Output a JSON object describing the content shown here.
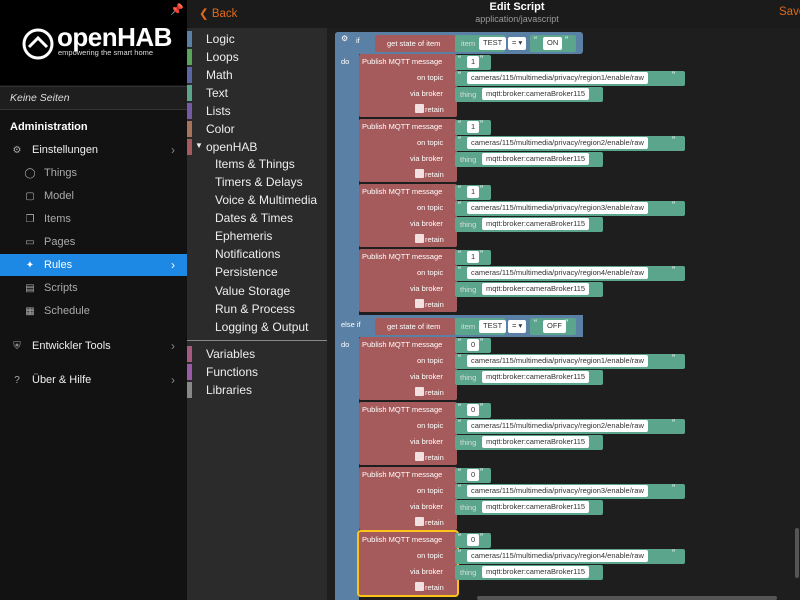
{
  "sidebar": {
    "logo_name": "openHAB",
    "logo_tagline": "empowering the smart home",
    "no_pages": "Keine Seiten",
    "admin_title": "Administration",
    "settings": "Einstellungen",
    "items": [
      {
        "label": "Things",
        "icon": "lightbulb-icon"
      },
      {
        "label": "Model",
        "icon": "cube-icon"
      },
      {
        "label": "Items",
        "icon": "items-icon"
      },
      {
        "label": "Pages",
        "icon": "monitor-icon"
      },
      {
        "label": "Rules",
        "icon": "sparkle-icon",
        "active": true
      },
      {
        "label": "Scripts",
        "icon": "document-icon"
      },
      {
        "label": "Schedule",
        "icon": "calendar-icon"
      }
    ],
    "dev_tools": "Entwickler Tools",
    "help": "Über & Hilfe"
  },
  "header": {
    "back": "Back",
    "title": "Edit Script",
    "subtitle": "application/javascript",
    "save": "Save"
  },
  "toolbox": {
    "categories": [
      {
        "label": "Logic",
        "color": "#5b80a5"
      },
      {
        "label": "Loops",
        "color": "#5ba55b"
      },
      {
        "label": "Math",
        "color": "#5b67a5"
      },
      {
        "label": "Text",
        "color": "#5ba58c"
      },
      {
        "label": "Lists",
        "color": "#745ba5"
      },
      {
        "label": "Color",
        "color": "#a5745b"
      },
      {
        "label": "openHAB",
        "color": "#a55b5b"
      }
    ],
    "openhab_sub": [
      "Items & Things",
      "Timers & Delays",
      "Voice & Multimedia",
      "Dates & Times",
      "Ephemeris",
      "Notifications",
      "Persistence",
      "Value Storage",
      "Run & Process",
      "Logging & Output"
    ],
    "bottom": [
      {
        "label": "Variables",
        "color": "#a55b80"
      },
      {
        "label": "Functions",
        "color": "#995ba5"
      },
      {
        "label": "Libraries",
        "color": "#888888"
      }
    ]
  },
  "blocks": {
    "if_label": "if",
    "elseif_label": "else if",
    "do_label": "do",
    "get_state": "get state of item",
    "item_label": "item",
    "item_name": "TEST",
    "eq": "= ▾",
    "on_value": "ON",
    "off_value": "OFF",
    "publish": "Publish MQTT message",
    "on_topic": "on topic",
    "via_broker": "via broker",
    "thing_label": "thing",
    "broker": "mqtt:broker:cameraBroker115",
    "retain": "retain",
    "group1": [
      {
        "payload": "1",
        "topic": "cameras/115/multimedia/privacy/region1/enable/raw"
      },
      {
        "payload": "1",
        "topic": "cameras/115/multimedia/privacy/region2/enable/raw"
      },
      {
        "payload": "1",
        "topic": "cameras/115/multimedia/privacy/region3/enable/raw"
      },
      {
        "payload": "1",
        "topic": "cameras/115/multimedia/privacy/region4/enable/raw"
      }
    ],
    "group2": [
      {
        "payload": "0",
        "topic": "cameras/115/multimedia/privacy/region1/enable/raw"
      },
      {
        "payload": "0",
        "topic": "cameras/115/multimedia/privacy/region2/enable/raw"
      },
      {
        "payload": "0",
        "topic": "cameras/115/multimedia/privacy/region3/enable/raw"
      },
      {
        "payload": "0",
        "topic": "cameras/115/multimedia/privacy/region4/enable/raw"
      }
    ]
  },
  "colors": {
    "accent": "#e06a1b",
    "active": "#1e88e5",
    "logic": "#5b80a5",
    "openhab": "#a55b5b",
    "text_block": "#5ba58c",
    "selected": "#fcc419"
  }
}
